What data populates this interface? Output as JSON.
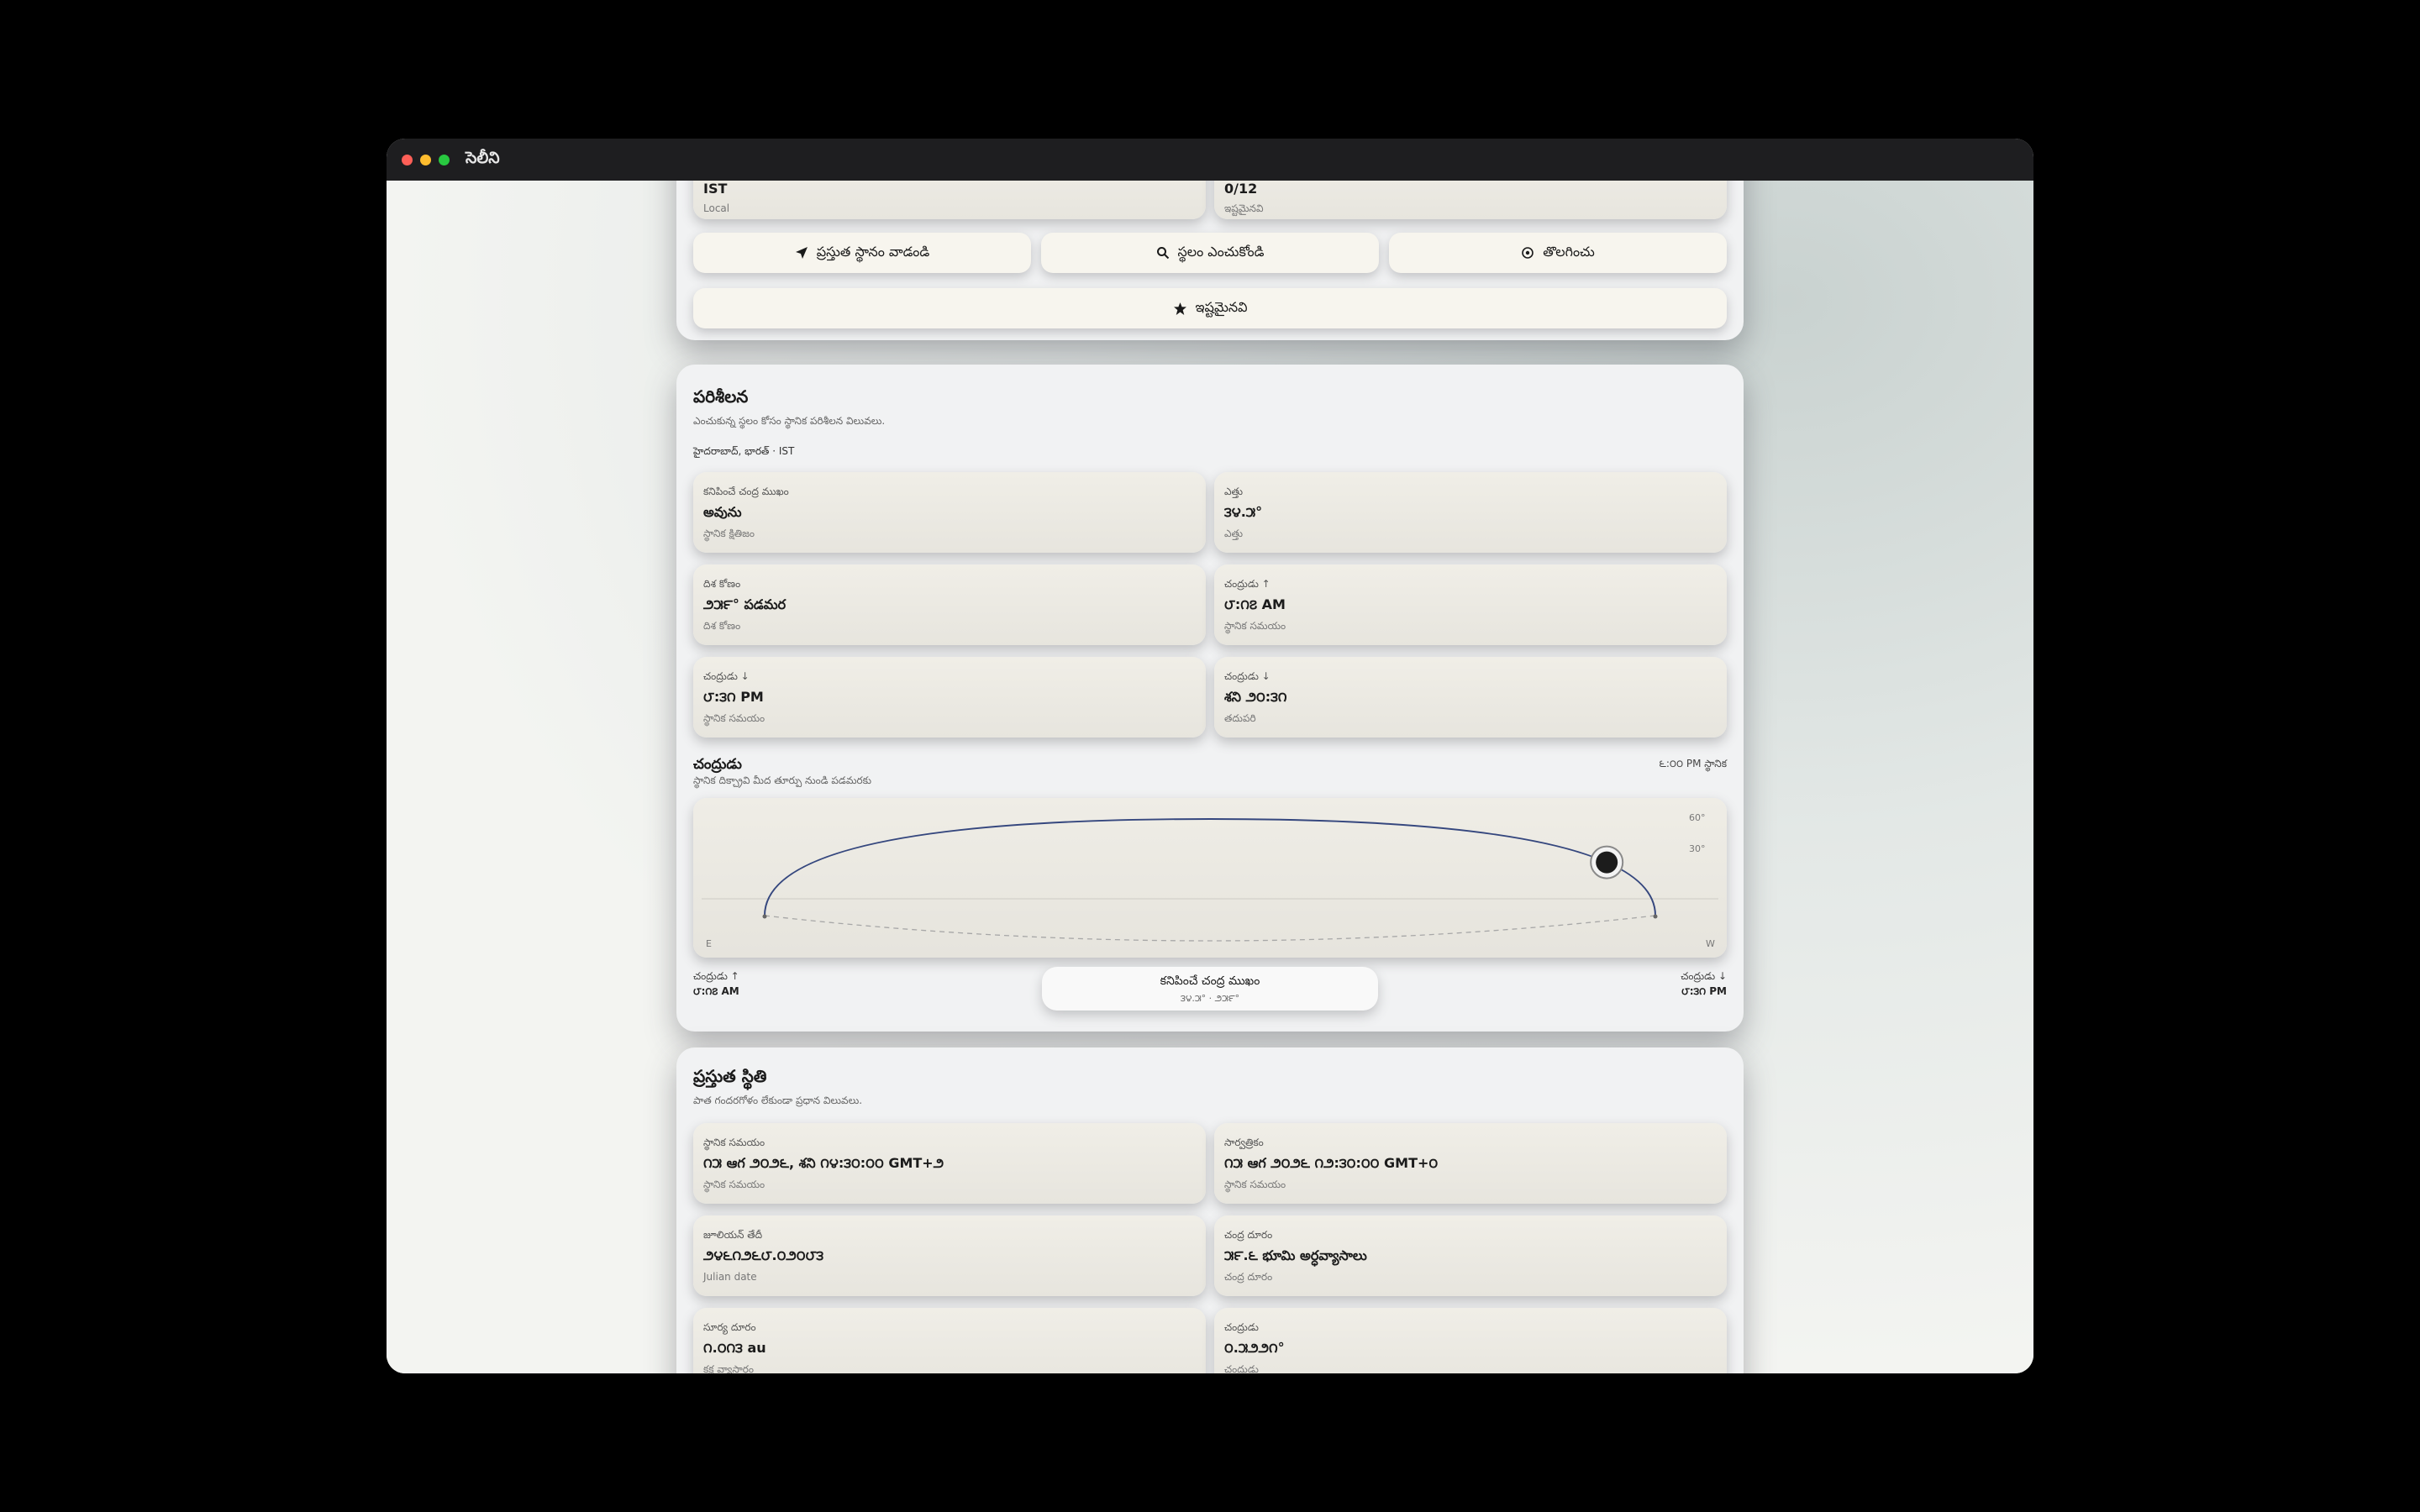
{
  "window": {
    "title": "సెలీని"
  },
  "top": {
    "card_left": {
      "value": "IST",
      "sub": "Local"
    },
    "card_right": {
      "value": "0/12",
      "sub": "ఇష్టమైనవి"
    },
    "buttons": {
      "current_location": "ప్రస్తుత స్థానం వాడండి",
      "choose_location": "స్థలం ఎంచుకోండి",
      "remove": "తొలగించు",
      "favorites": "ఇష్టమైనవి"
    }
  },
  "observation": {
    "title": "పరిశీలన",
    "subtitle": "ఎంచుకున్న స్థలం కోసం స్థానిక పరిశీలన విలువలు.",
    "location": "హైదరాబాద్, భారత్ · IST",
    "cards": [
      {
        "label": "కనిపించే చంద్ర ముఖం",
        "value": "అవును",
        "sub": "స్థానిక క్షితిజం"
      },
      {
        "label": "ఎత్తు",
        "value": "౩౪.౫°",
        "sub": "ఎత్తు"
      },
      {
        "label": "దిశ కోణం",
        "value": "౨౫౯° పడమర",
        "sub": "దిశ కోణం"
      },
      {
        "label": "చంద్రుడు ↑",
        "value": "౮:౧౭ AM",
        "sub": "స్థానిక సమయం"
      },
      {
        "label": "చంద్రుడు ↓",
        "value": "౮:౩౧ PM",
        "sub": "స్థానిక సమయం"
      },
      {
        "label": "చంద్రుడు ↓",
        "value": "శని ౨౦:౩౧",
        "sub": "తదుపరి"
      }
    ],
    "moon_chart": {
      "title": "చంద్రుడు",
      "subtitle": "స్థానిక దిక్చ్రావి మీద తూర్పు నుండి పడమరకు",
      "time_label": "౬:౦౦ PM స్థానిక",
      "tick_60": "60°",
      "tick_30": "30°",
      "east": "E",
      "west": "W",
      "moon_progress": 0.92
    },
    "rise": {
      "label": "చంద్రుడు ↑",
      "time": "౮:౧౭ AM"
    },
    "set": {
      "label": "చంద్రుడు ↓",
      "time": "౮:౩౧ PM"
    },
    "pill": {
      "title": "కనిపించే చంద్ర ముఖం",
      "value": "౩౪.౫° · ౨౫౯°"
    }
  },
  "current": {
    "title": "ప్రస్తుత స్థితి",
    "subtitle": "పాత గందరగోళం లేకుండా ప్రధాన విలువలు.",
    "cards": [
      {
        "label": "స్థానిక సమయం",
        "value": "౧౫ ఆగ ౨౦౨౬, శని ౧౪:౩౦:౦౦ GMT+౨",
        "sub": "స్థానిక సమయం"
      },
      {
        "label": "సార్వత్రికం",
        "value": "౧౫ ఆగ ౨౦౨౬ ౧౨:౩౦:౦౦ GMT+౦",
        "sub": "స్థానిక సమయం"
      },
      {
        "label": "జూలియన్ తేదీ",
        "value": "౨౪౬౧౨౬౮.౦౨౦౮౩",
        "sub": "Julian date"
      },
      {
        "label": "చంద్ర దూరం",
        "value": "౫౯.౬ భూమి అర్ధవ్యాసాలు",
        "sub": "చంద్ర దూరం"
      },
      {
        "label": "సూర్య దూరం",
        "value": "౧.౦౧౩ au",
        "sub": "కక్ష వ్యాసార్థం"
      },
      {
        "label": "చంద్రుడు",
        "value": "౦.౫౨౨౧°",
        "sub": "చంద్రుడు"
      }
    ]
  }
}
